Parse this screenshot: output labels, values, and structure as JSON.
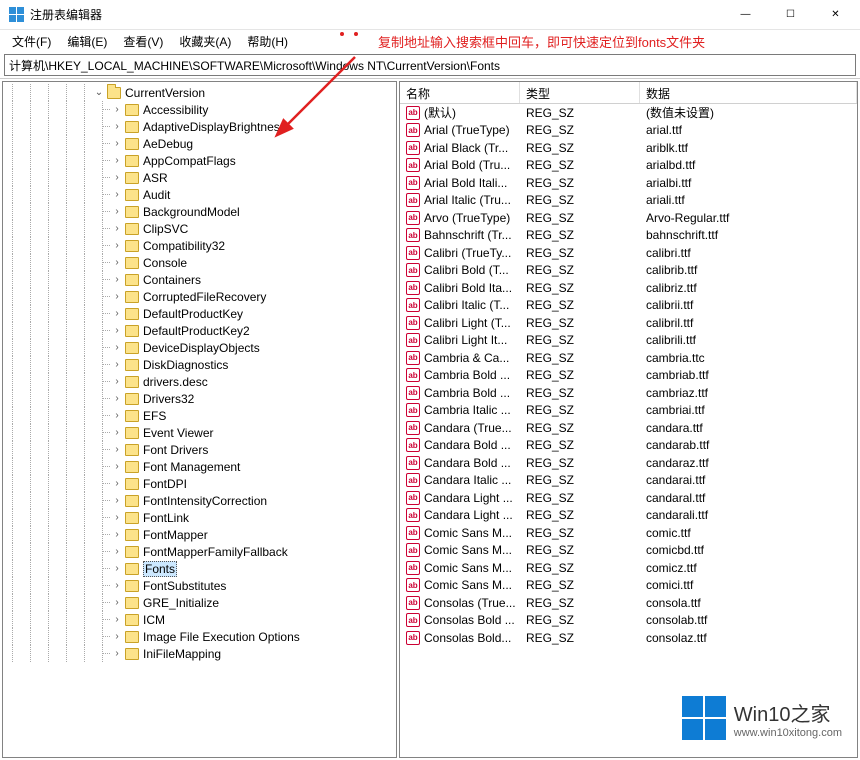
{
  "window": {
    "title": "注册表编辑器",
    "min": "—",
    "max": "☐",
    "close": "✕"
  },
  "menu": {
    "items": [
      {
        "label": "文件(F)"
      },
      {
        "label": "编辑(E)"
      },
      {
        "label": "查看(V)"
      },
      {
        "label": "收藏夹(A)"
      },
      {
        "label": "帮助(H)"
      }
    ]
  },
  "annotation": {
    "text": "复制地址输入搜索框中回车，即可快速定位到fonts文件夹"
  },
  "address": {
    "path": "计算机\\HKEY_LOCAL_MACHINE\\SOFTWARE\\Microsoft\\Windows NT\\CurrentVersion\\Fonts"
  },
  "tree": {
    "parent": {
      "label": "CurrentVersion",
      "expanded": true
    },
    "items": [
      {
        "label": "Accessibility"
      },
      {
        "label": "AdaptiveDisplayBrightness"
      },
      {
        "label": "AeDebug"
      },
      {
        "label": "AppCompatFlags"
      },
      {
        "label": "ASR"
      },
      {
        "label": "Audit"
      },
      {
        "label": "BackgroundModel"
      },
      {
        "label": "ClipSVC"
      },
      {
        "label": "Compatibility32"
      },
      {
        "label": "Console"
      },
      {
        "label": "Containers"
      },
      {
        "label": "CorruptedFileRecovery"
      },
      {
        "label": "DefaultProductKey"
      },
      {
        "label": "DefaultProductKey2"
      },
      {
        "label": "DeviceDisplayObjects"
      },
      {
        "label": "DiskDiagnostics"
      },
      {
        "label": "drivers.desc"
      },
      {
        "label": "Drivers32"
      },
      {
        "label": "EFS"
      },
      {
        "label": "Event Viewer"
      },
      {
        "label": "Font Drivers"
      },
      {
        "label": "Font Management"
      },
      {
        "label": "FontDPI"
      },
      {
        "label": "FontIntensityCorrection"
      },
      {
        "label": "FontLink"
      },
      {
        "label": "FontMapper"
      },
      {
        "label": "FontMapperFamilyFallback"
      },
      {
        "label": "Fonts",
        "selected": true
      },
      {
        "label": "FontSubstitutes"
      },
      {
        "label": "GRE_Initialize"
      },
      {
        "label": "ICM"
      },
      {
        "label": "Image File Execution Options"
      },
      {
        "label": "IniFileMapping"
      }
    ]
  },
  "list": {
    "headers": {
      "name": "名称",
      "type": "类型",
      "data": "数据"
    },
    "rows": [
      {
        "name": "(默认)",
        "type": "REG_SZ",
        "data": "(数值未设置)"
      },
      {
        "name": "Arial (TrueType)",
        "type": "REG_SZ",
        "data": "arial.ttf"
      },
      {
        "name": "Arial Black (Tr...",
        "type": "REG_SZ",
        "data": "ariblk.ttf"
      },
      {
        "name": "Arial Bold (Tru...",
        "type": "REG_SZ",
        "data": "arialbd.ttf"
      },
      {
        "name": "Arial Bold Itali...",
        "type": "REG_SZ",
        "data": "arialbi.ttf"
      },
      {
        "name": "Arial Italic (Tru...",
        "type": "REG_SZ",
        "data": "ariali.ttf"
      },
      {
        "name": "Arvo (TrueType)",
        "type": "REG_SZ",
        "data": "Arvo-Regular.ttf"
      },
      {
        "name": "Bahnschrift (Tr...",
        "type": "REG_SZ",
        "data": "bahnschrift.ttf"
      },
      {
        "name": "Calibri (TrueTy...",
        "type": "REG_SZ",
        "data": "calibri.ttf"
      },
      {
        "name": "Calibri Bold (T...",
        "type": "REG_SZ",
        "data": "calibrib.ttf"
      },
      {
        "name": "Calibri Bold Ita...",
        "type": "REG_SZ",
        "data": "calibriz.ttf"
      },
      {
        "name": "Calibri Italic (T...",
        "type": "REG_SZ",
        "data": "calibrii.ttf"
      },
      {
        "name": "Calibri Light (T...",
        "type": "REG_SZ",
        "data": "calibril.ttf"
      },
      {
        "name": "Calibri Light It...",
        "type": "REG_SZ",
        "data": "calibrili.ttf"
      },
      {
        "name": "Cambria & Ca...",
        "type": "REG_SZ",
        "data": "cambria.ttc"
      },
      {
        "name": "Cambria Bold ...",
        "type": "REG_SZ",
        "data": "cambriab.ttf"
      },
      {
        "name": "Cambria Bold ...",
        "type": "REG_SZ",
        "data": "cambriaz.ttf"
      },
      {
        "name": "Cambria Italic ...",
        "type": "REG_SZ",
        "data": "cambriai.ttf"
      },
      {
        "name": "Candara (True...",
        "type": "REG_SZ",
        "data": "candara.ttf"
      },
      {
        "name": "Candara Bold ...",
        "type": "REG_SZ",
        "data": "candarab.ttf"
      },
      {
        "name": "Candara Bold ...",
        "type": "REG_SZ",
        "data": "candaraz.ttf"
      },
      {
        "name": "Candara Italic ...",
        "type": "REG_SZ",
        "data": "candarai.ttf"
      },
      {
        "name": "Candara Light ...",
        "type": "REG_SZ",
        "data": "candaral.ttf"
      },
      {
        "name": "Candara Light ...",
        "type": "REG_SZ",
        "data": "candarali.ttf"
      },
      {
        "name": "Comic Sans M...",
        "type": "REG_SZ",
        "data": "comic.ttf"
      },
      {
        "name": "Comic Sans M...",
        "type": "REG_SZ",
        "data": "comicbd.ttf"
      },
      {
        "name": "Comic Sans M...",
        "type": "REG_SZ",
        "data": "comicz.ttf"
      },
      {
        "name": "Comic Sans M...",
        "type": "REG_SZ",
        "data": "comici.ttf"
      },
      {
        "name": "Consolas (True...",
        "type": "REG_SZ",
        "data": "consola.ttf"
      },
      {
        "name": "Consolas Bold ...",
        "type": "REG_SZ",
        "data": "consolab.ttf"
      },
      {
        "name": "Consolas Bold...",
        "type": "REG_SZ",
        "data": "consolaz.ttf"
      }
    ]
  },
  "watermark": {
    "big": "Win10之家",
    "small": "www.win10xitong.com"
  }
}
